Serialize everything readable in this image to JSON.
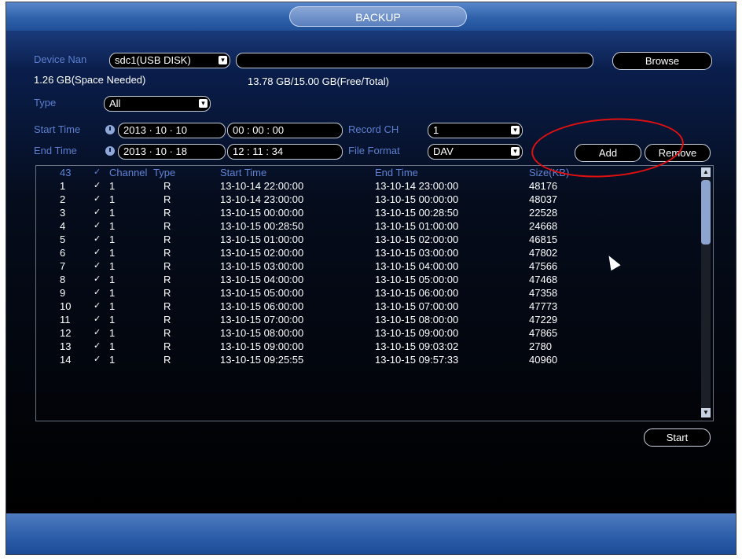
{
  "window": {
    "title": "BACKUP"
  },
  "device": {
    "label": "Device Nan",
    "select_value": "sdc1(USB DISK)",
    "path_value": "",
    "browse_label": "Browse"
  },
  "space": {
    "needed": "1.26 GB(Space Needed)",
    "free_total": "13.78 GB/15.00 GB(Free/Total)"
  },
  "type": {
    "label": "Type",
    "value": "All"
  },
  "start": {
    "label": "Start Time",
    "date": "2013 · 10 · 10",
    "time": "00 : 00 : 00"
  },
  "end": {
    "label": "End Time",
    "date": "2013 · 10 · 18",
    "time": "12 : 11 : 34"
  },
  "record_ch": {
    "label": "Record CH",
    "value": "1"
  },
  "file_format": {
    "label": "File Format",
    "value": "DAV"
  },
  "buttons": {
    "add": "Add",
    "remove": "Remove",
    "start": "Start"
  },
  "table": {
    "headers": {
      "count": "43",
      "channel": "Channel",
      "type": "Type",
      "start": "Start Time",
      "end": "End Time",
      "size": "Size(KB)"
    },
    "rows": [
      {
        "idx": "1",
        "ch": "1",
        "type": "R",
        "start": "13-10-14 22:00:00",
        "end": "13-10-14 23:00:00",
        "size": "48176"
      },
      {
        "idx": "2",
        "ch": "1",
        "type": "R",
        "start": "13-10-14 23:00:00",
        "end": "13-10-15 00:00:00",
        "size": "48037"
      },
      {
        "idx": "3",
        "ch": "1",
        "type": "R",
        "start": "13-10-15 00:00:00",
        "end": "13-10-15 00:28:50",
        "size": "22528"
      },
      {
        "idx": "4",
        "ch": "1",
        "type": "R",
        "start": "13-10-15 00:28:50",
        "end": "13-10-15 01:00:00",
        "size": "24668"
      },
      {
        "idx": "5",
        "ch": "1",
        "type": "R",
        "start": "13-10-15 01:00:00",
        "end": "13-10-15 02:00:00",
        "size": "46815"
      },
      {
        "idx": "6",
        "ch": "1",
        "type": "R",
        "start": "13-10-15 02:00:00",
        "end": "13-10-15 03:00:00",
        "size": "47802"
      },
      {
        "idx": "7",
        "ch": "1",
        "type": "R",
        "start": "13-10-15 03:00:00",
        "end": "13-10-15 04:00:00",
        "size": "47566"
      },
      {
        "idx": "8",
        "ch": "1",
        "type": "R",
        "start": "13-10-15 04:00:00",
        "end": "13-10-15 05:00:00",
        "size": "47468"
      },
      {
        "idx": "9",
        "ch": "1",
        "type": "R",
        "start": "13-10-15 05:00:00",
        "end": "13-10-15 06:00:00",
        "size": "47358"
      },
      {
        "idx": "10",
        "ch": "1",
        "type": "R",
        "start": "13-10-15 06:00:00",
        "end": "13-10-15 07:00:00",
        "size": "47773"
      },
      {
        "idx": "11",
        "ch": "1",
        "type": "R",
        "start": "13-10-15 07:00:00",
        "end": "13-10-15 08:00:00",
        "size": "47229"
      },
      {
        "idx": "12",
        "ch": "1",
        "type": "R",
        "start": "13-10-15 08:00:00",
        "end": "13-10-15 09:00:00",
        "size": "47865"
      },
      {
        "idx": "13",
        "ch": "1",
        "type": "R",
        "start": "13-10-15 09:00:00",
        "end": "13-10-15 09:03:02",
        "size": "2780"
      },
      {
        "idx": "14",
        "ch": "1",
        "type": "R",
        "start": "13-10-15 09:25:55",
        "end": "13-10-15 09:57:33",
        "size": "40960"
      }
    ]
  },
  "colors": {
    "label_blue": "#5c7fcf",
    "title_blue": "#2e62ab",
    "annotation_red": "#e01010"
  },
  "icons": {
    "clock": "clock-icon",
    "dropdown": "dropdown-arrow-icon",
    "check": "checkmark-icon",
    "cursor": "mouse-cursor-icon"
  }
}
